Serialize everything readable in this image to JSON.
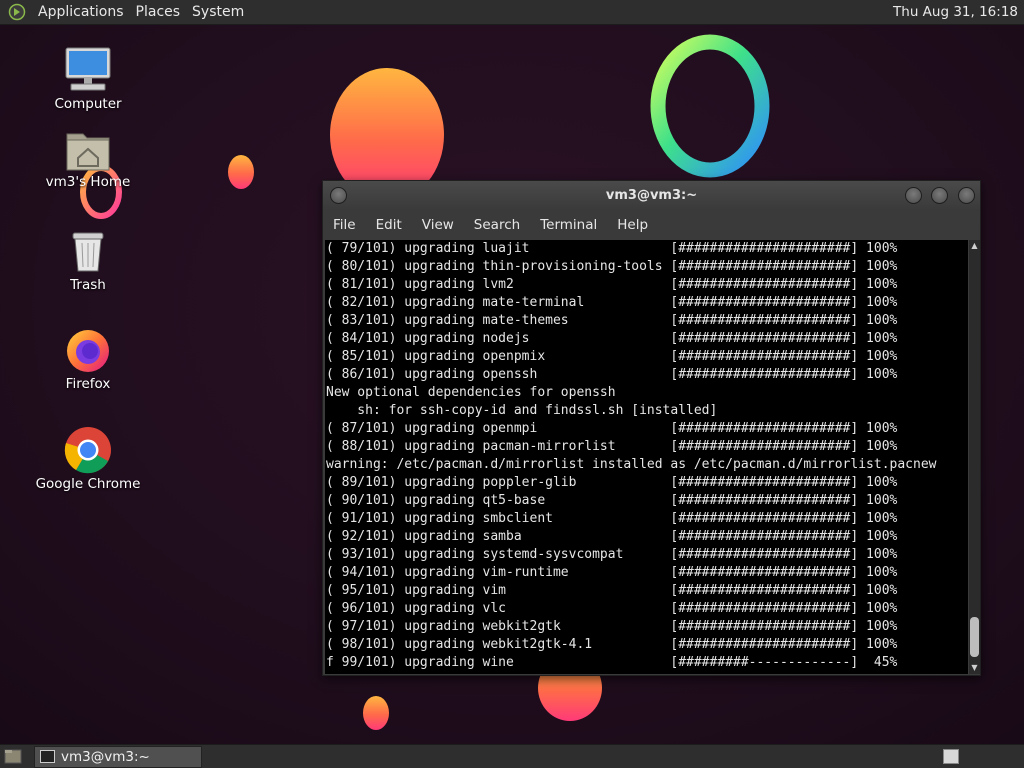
{
  "top_panel": {
    "menus": [
      "Applications",
      "Places",
      "System"
    ],
    "clock": "Thu Aug 31, 16:18"
  },
  "desktop_icons": {
    "computer": "Computer",
    "home": "vm3's Home",
    "trash": "Trash",
    "firefox": "Firefox",
    "chrome": "Google Chrome"
  },
  "terminal": {
    "title": "vm3@vm3:~",
    "menus": [
      "File",
      "Edit",
      "View",
      "Search",
      "Terminal",
      "Help"
    ],
    "lines": [
      "( 79/101) upgrading luajit                  [######################] 100%",
      "( 80/101) upgrading thin-provisioning-tools [######################] 100%",
      "( 81/101) upgrading lvm2                    [######################] 100%",
      "( 82/101) upgrading mate-terminal           [######################] 100%",
      "( 83/101) upgrading mate-themes             [######################] 100%",
      "( 84/101) upgrading nodejs                  [######################] 100%",
      "( 85/101) upgrading openpmix                [######################] 100%",
      "( 86/101) upgrading openssh                 [######################] 100%",
      "New optional dependencies for openssh",
      "    sh: for ssh-copy-id and findssl.sh [installed]",
      "( 87/101) upgrading openmpi                 [######################] 100%",
      "( 88/101) upgrading pacman-mirrorlist       [######################] 100%",
      "warning: /etc/pacman.d/mirrorlist installed as /etc/pacman.d/mirrorlist.pacnew",
      "( 89/101) upgrading poppler-glib            [######################] 100%",
      "( 90/101) upgrading qt5-base                [######################] 100%",
      "( 91/101) upgrading smbclient               [######################] 100%",
      "( 92/101) upgrading samba                   [######################] 100%",
      "( 93/101) upgrading systemd-sysvcompat      [######################] 100%",
      "( 94/101) upgrading vim-runtime             [######################] 100%",
      "( 95/101) upgrading vim                     [######################] 100%",
      "( 96/101) upgrading vlc                     [######################] 100%",
      "( 97/101) upgrading webkit2gtk              [######################] 100%",
      "( 98/101) upgrading webkit2gtk-4.1          [######################] 100%",
      "f 99/101) upgrading wine                    [#########-------------]  45%"
    ]
  },
  "taskbar": {
    "task_label": "vm3@vm3:~"
  }
}
